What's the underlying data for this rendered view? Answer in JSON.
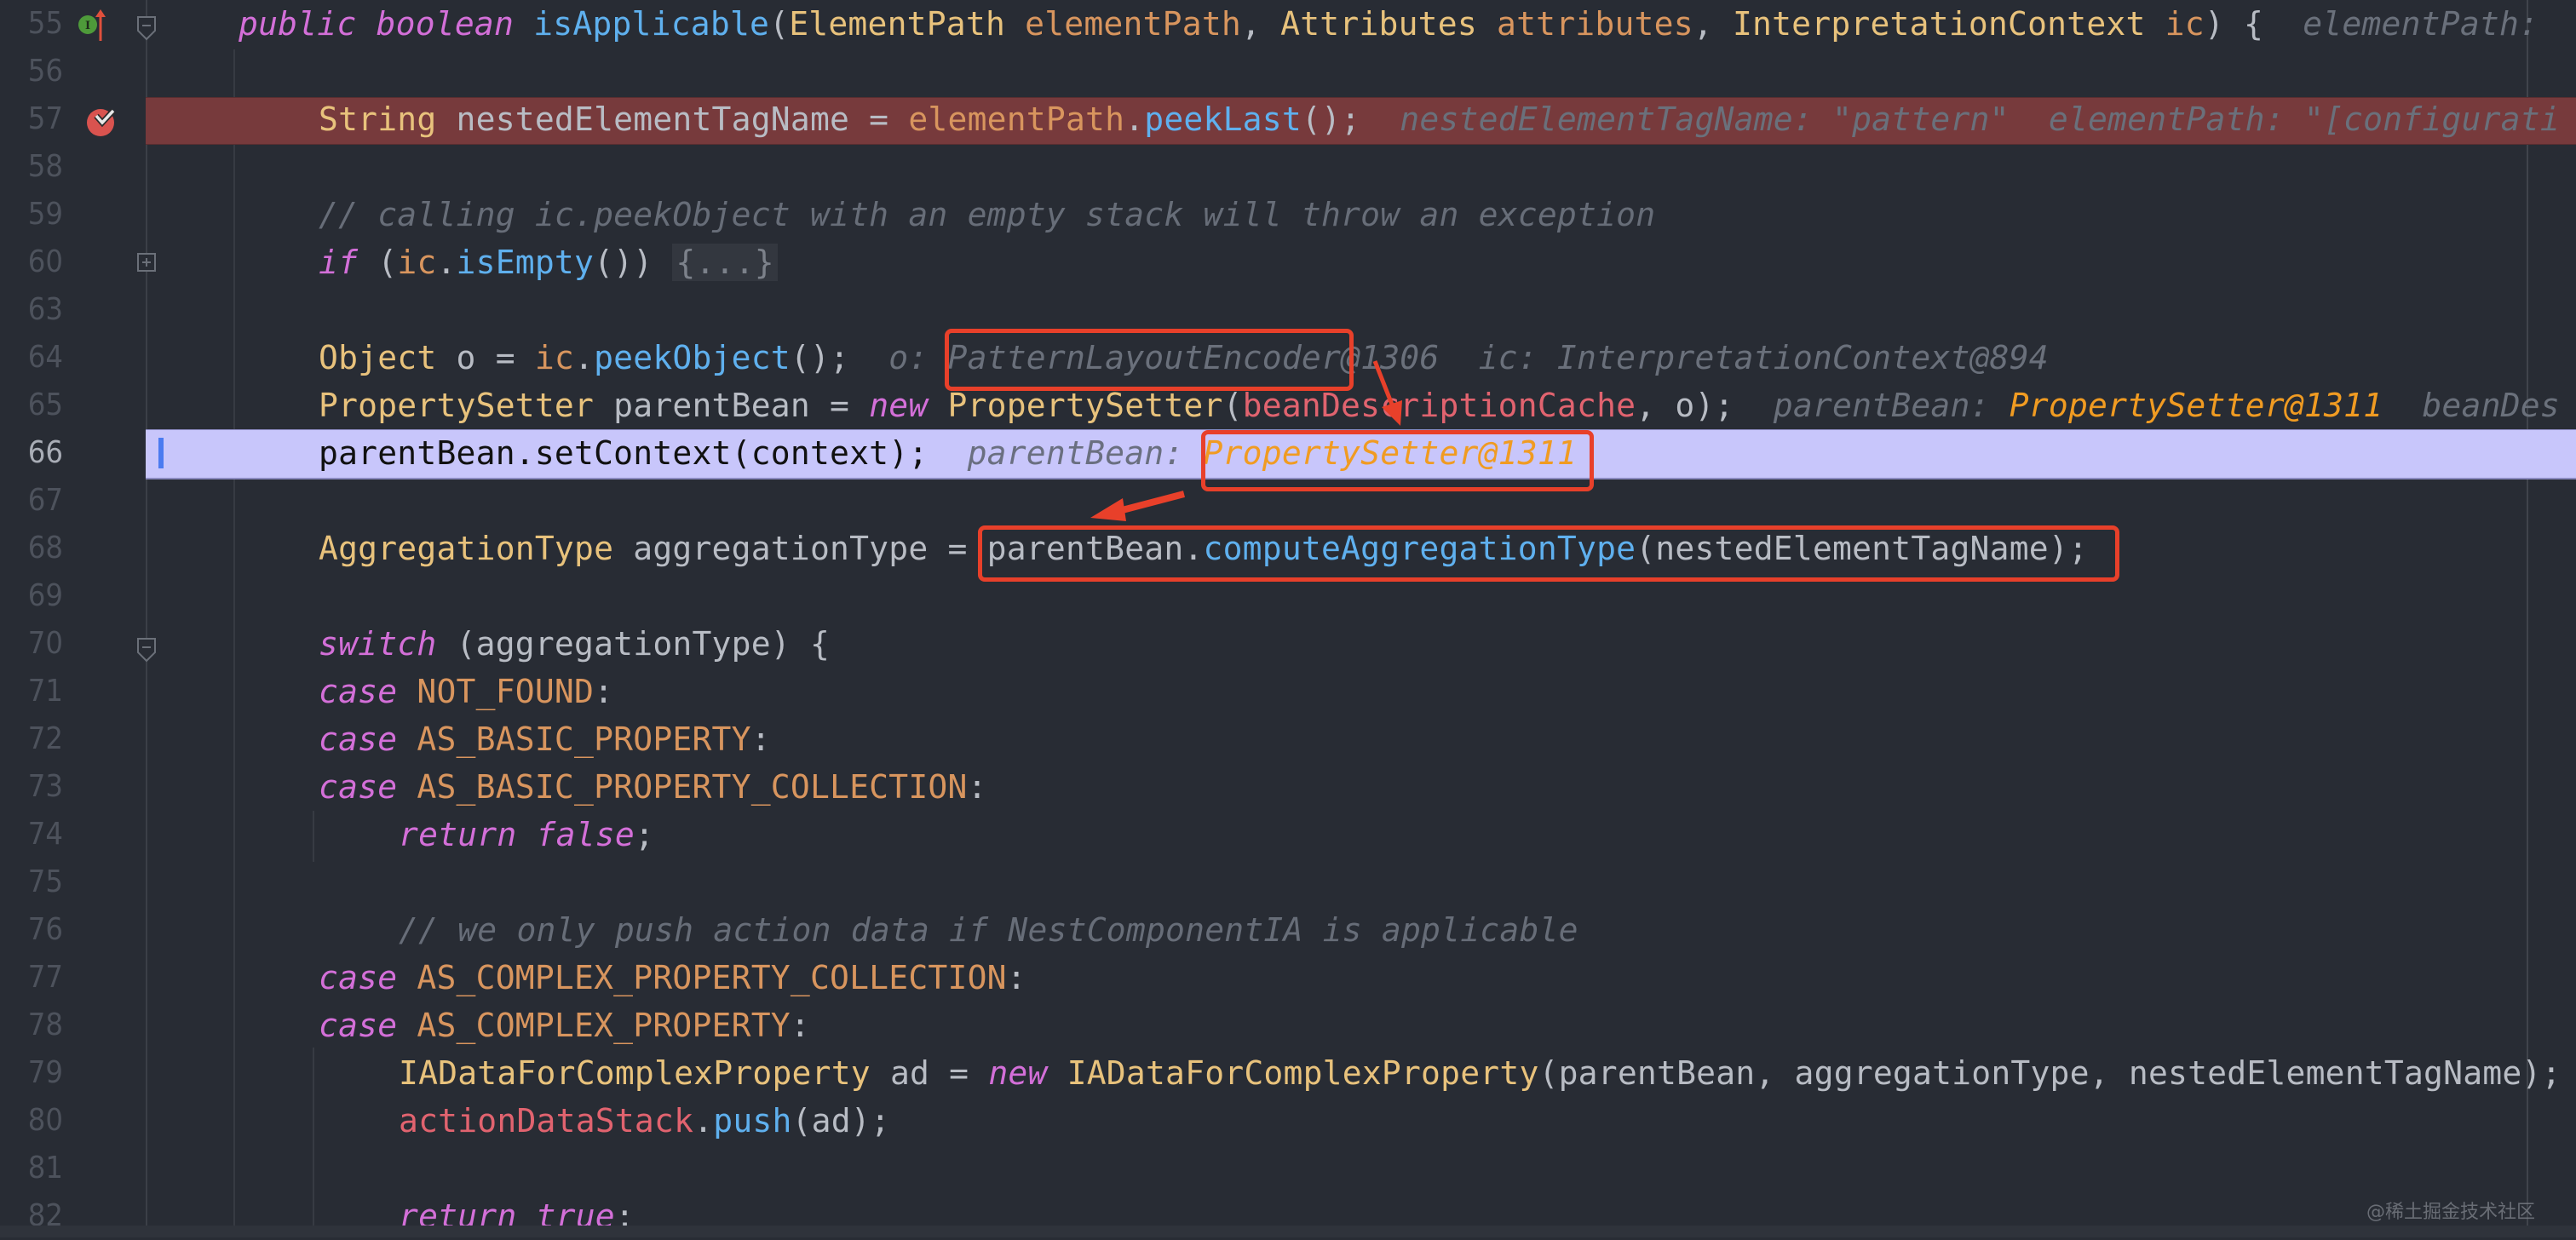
{
  "editor": {
    "lines": [
      {
        "n": "55",
        "kind": "normal"
      },
      {
        "n": "56",
        "kind": "normal"
      },
      {
        "n": "57",
        "kind": "breakpoint"
      },
      {
        "n": "58",
        "kind": "normal"
      },
      {
        "n": "59",
        "kind": "normal"
      },
      {
        "n": "60",
        "kind": "normal"
      },
      {
        "n": "63",
        "kind": "normal"
      },
      {
        "n": "64",
        "kind": "normal"
      },
      {
        "n": "65",
        "kind": "normal"
      },
      {
        "n": "66",
        "kind": "execution"
      },
      {
        "n": "67",
        "kind": "normal"
      },
      {
        "n": "68",
        "kind": "normal"
      },
      {
        "n": "69",
        "kind": "normal"
      },
      {
        "n": "70",
        "kind": "normal"
      },
      {
        "n": "71",
        "kind": "normal"
      },
      {
        "n": "72",
        "kind": "normal"
      },
      {
        "n": "73",
        "kind": "normal"
      },
      {
        "n": "74",
        "kind": "normal"
      },
      {
        "n": "75",
        "kind": "normal"
      },
      {
        "n": "76",
        "kind": "normal"
      },
      {
        "n": "77",
        "kind": "normal"
      },
      {
        "n": "78",
        "kind": "normal"
      },
      {
        "n": "79",
        "kind": "normal"
      },
      {
        "n": "80",
        "kind": "normal"
      },
      {
        "n": "81",
        "kind": "normal"
      },
      {
        "n": "82",
        "kind": "normal"
      }
    ],
    "code": {
      "l55": {
        "kw1": "public",
        "kw2": "boolean",
        "fn": "isApplicable",
        "p1": "(",
        "t1": "ElementPath",
        "a1": "elementPath",
        "c1": ", ",
        "t2": "Attributes",
        "a2": "attributes",
        "c2": ", ",
        "t3": "InterpretationContext",
        "a3": "ic",
        "end": ") {",
        "hint": "elementPath:"
      },
      "l57": {
        "t": "String",
        "v": " nestedElementTagName = ",
        "p": "elementPath",
        "dot": ".",
        "fn": "peekLast",
        "end": "();",
        "hint1": "nestedElementTagName: \"pattern\"",
        "hint2": "elementPath: \"[configurati"
      },
      "l59": {
        "comment": "// calling ic.peekObject with an empty stack will throw an exception"
      },
      "l60": {
        "kw": "if",
        "open": " (",
        "p": "ic",
        "dot": ".",
        "fn": "isEmpty",
        "close": "()) ",
        "folded": "{...}"
      },
      "l64": {
        "t": "Object",
        "v": " o = ",
        "p": "ic",
        "dot": ".",
        "fn": "peekObject",
        "end": "();",
        "hint_o_label": "o: ",
        "hint_o_value": "PatternLayoutEncoder@1306",
        "hint_ic": "ic: InterpretationContext@894"
      },
      "l65": {
        "t": "PropertySetter",
        "v": " parentBean = ",
        "kw": "new",
        "t2": "PropertySetter",
        "open": "(",
        "fld": "beanDescriptionCache",
        "rest": ", o);",
        "hint_label": "parentBean: ",
        "hint_value": "PropertySetter@1311",
        "hint_more": "beanDes"
      },
      "l66": {
        "stmt": "parentBean.setContext(context);",
        "hint_label": "parentBean: ",
        "hint_value": "PropertySetter@1311"
      },
      "l68": {
        "t": "AggregationType",
        "v": " aggregationType = ",
        "obj": "parentBean",
        "dot": ".",
        "fn": "computeAggregationType",
        "args": "(nestedElementTagName);"
      },
      "l70": {
        "kw": "switch",
        "rest": " (aggregationType) {"
      },
      "l71": {
        "kw": "case",
        "c": "NOT_FOUND",
        "end": ":"
      },
      "l72": {
        "kw": "case",
        "c": "AS_BASIC_PROPERTY",
        "end": ":"
      },
      "l73": {
        "kw": "case",
        "c": "AS_BASIC_PROPERTY_COLLECTION",
        "end": ":"
      },
      "l74": {
        "kw1": "return",
        "kw2": "false",
        "end": ";"
      },
      "l76": {
        "comment": "// we only push action data if NestComponentIA is applicable"
      },
      "l77": {
        "kw": "case",
        "c": "AS_COMPLEX_PROPERTY_COLLECTION",
        "end": ":"
      },
      "l78": {
        "kw": "case",
        "c": "AS_COMPLEX_PROPERTY",
        "end": ":"
      },
      "l79": {
        "t": "IADataForComplexProperty",
        "v": " ad = ",
        "kw": "new",
        "t2": "IADataForComplexProperty",
        "args": "(parentBean, aggregationType, nestedElementTagName);"
      },
      "l80": {
        "fld": "actionDataStack",
        "dot": ".",
        "fn": "push",
        "args": "(ad);"
      },
      "l82": {
        "kw1": "return",
        "kw2": "true",
        "end": ";"
      }
    }
  },
  "gutter_icons": {
    "l55": [
      "implementing-method-icon",
      "go-to-super-arrow-icon"
    ],
    "l57": [
      "breakpoint-verified-icon"
    ]
  },
  "colors": {
    "background": "#282c34",
    "breakpoint_line": "#773a3c",
    "execution_line": "#c8c6fb",
    "annotation": "#e8402a",
    "debug_value": "#f09b22"
  },
  "watermark": "@稀土掘金技术社区"
}
